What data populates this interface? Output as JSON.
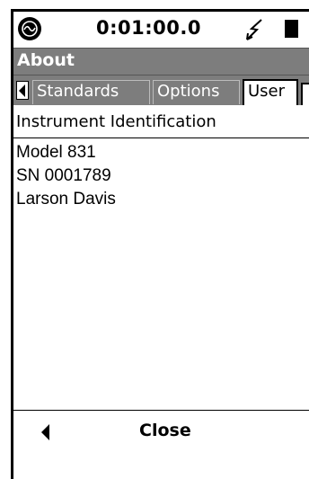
{
  "status": {
    "timer": "0:01:00.0",
    "logo_icon": "larson-davis-logo-icon",
    "power_icon": "lightning-bolt-icon",
    "battery_icon": "battery-icon"
  },
  "title": "About",
  "tabs": [
    {
      "label": "Standards",
      "active": false
    },
    {
      "label": "Options",
      "active": false
    },
    {
      "label": "User",
      "active": true
    }
  ],
  "content": {
    "section_header": "Instrument Identification",
    "lines": [
      "Model 831",
      "SN 0001789",
      "Larson Davis"
    ]
  },
  "footer": {
    "back_icon": "left-arrow-icon",
    "close_label": "Close"
  },
  "colors": {
    "titlebar": "#7d7d7d",
    "title_text": "#ffffff"
  }
}
